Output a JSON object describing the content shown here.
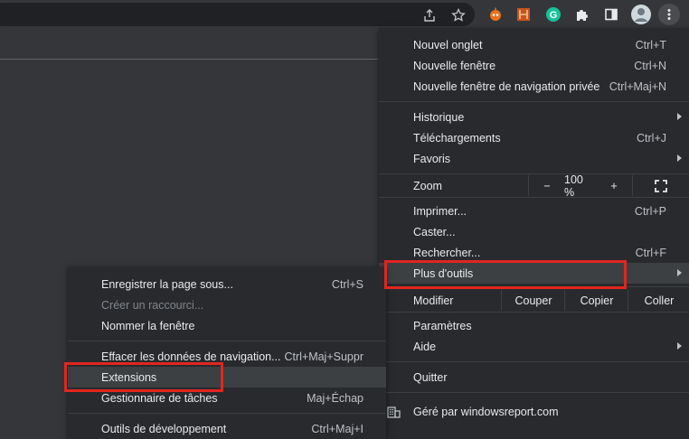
{
  "toolbar": {
    "icons": [
      "share-icon",
      "bookmark-star-icon",
      "extension-robot-icon",
      "extension-puzzle-orange-icon",
      "grammarly-icon",
      "extensions-puzzle-icon",
      "side-panel-icon",
      "profile-avatar-icon",
      "kebab-menu-icon"
    ]
  },
  "main_menu": {
    "new_tab": {
      "label": "Nouvel onglet",
      "shortcut": "Ctrl+T"
    },
    "new_window": {
      "label": "Nouvelle fenêtre",
      "shortcut": "Ctrl+N"
    },
    "new_incognito": {
      "label": "Nouvelle fenêtre de navigation privée",
      "shortcut": "Ctrl+Maj+N"
    },
    "history": {
      "label": "Historique"
    },
    "downloads": {
      "label": "Téléchargements",
      "shortcut": "Ctrl+J"
    },
    "bookmarks": {
      "label": "Favoris"
    },
    "zoom": {
      "label": "Zoom",
      "minus": "−",
      "value": "100 %",
      "plus": "+"
    },
    "print": {
      "label": "Imprimer...",
      "shortcut": "Ctrl+P"
    },
    "cast": {
      "label": "Caster..."
    },
    "find": {
      "label": "Rechercher...",
      "shortcut": "Ctrl+F"
    },
    "more_tools": {
      "label": "Plus d'outils"
    },
    "edit": {
      "label": "Modifier",
      "cut": "Couper",
      "copy": "Copier",
      "paste": "Coller"
    },
    "settings": {
      "label": "Paramètres"
    },
    "help": {
      "label": "Aide"
    },
    "quit": {
      "label": "Quitter"
    },
    "managed": {
      "label": "Géré par windowsreport.com"
    }
  },
  "sub_menu": {
    "save_page": {
      "label": "Enregistrer la page sous...",
      "shortcut": "Ctrl+S"
    },
    "create_shortcut": {
      "label": "Créer un raccourci..."
    },
    "name_window": {
      "label": "Nommer la fenêtre"
    },
    "clear_data": {
      "label": "Effacer les données de navigation...",
      "shortcut": "Ctrl+Maj+Suppr"
    },
    "extensions": {
      "label": "Extensions"
    },
    "task_manager": {
      "label": "Gestionnaire de tâches",
      "shortcut": "Maj+Échap"
    },
    "dev_tools": {
      "label": "Outils de développement",
      "shortcut": "Ctrl+Maj+I"
    }
  },
  "colors": {
    "highlight_box": "#e0261f",
    "menu_bg": "#292a2d",
    "page_bg": "#35363a"
  }
}
